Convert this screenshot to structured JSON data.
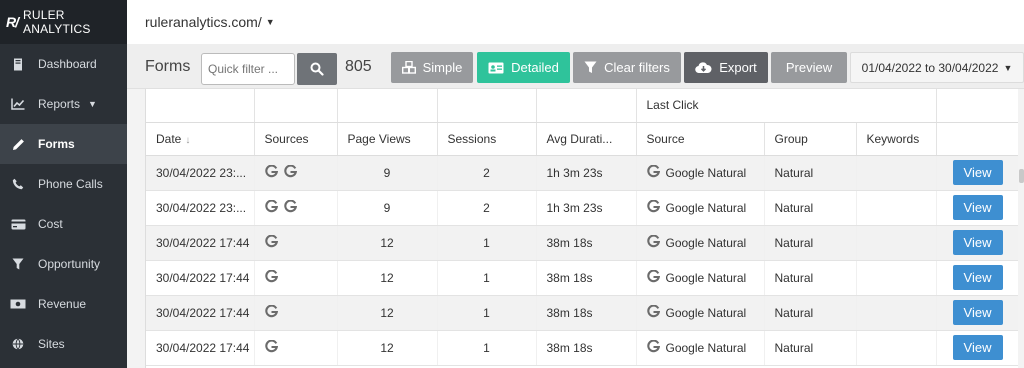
{
  "brand": {
    "mark": "R/",
    "name": "RULER ANALYTICS"
  },
  "sidebar": {
    "items": [
      {
        "label": "Dashboard",
        "icon": "dashboard-icon",
        "active": false
      },
      {
        "label": "Reports",
        "icon": "chart-icon",
        "active": false,
        "has_caret": true
      },
      {
        "label": "Forms",
        "icon": "pencil-icon",
        "active": true
      },
      {
        "label": "Phone Calls",
        "icon": "phone-icon",
        "active": false
      },
      {
        "label": "Cost",
        "icon": "credit-card-icon",
        "active": false
      },
      {
        "label": "Opportunity",
        "icon": "filter-icon",
        "active": false
      },
      {
        "label": "Revenue",
        "icon": "money-icon",
        "active": false
      },
      {
        "label": "Sites",
        "icon": "globe-icon",
        "active": false
      }
    ]
  },
  "topbar": {
    "site": "ruleranalytics.com/"
  },
  "toolbar": {
    "title": "Forms",
    "quick_filter_placeholder": "Quick filter ...",
    "count": "805",
    "simple_label": "Simple",
    "detailed_label": "Detailed",
    "clear_label": "Clear filters",
    "export_label": "Export",
    "preview_label": "Preview",
    "date_range": "01/04/2022 to 30/04/2022"
  },
  "table": {
    "group_header": "Last Click",
    "columns": [
      "Date",
      "Sources",
      "Page Views",
      "Sessions",
      "Avg Durati...",
      "Source",
      "Group",
      "Keywords"
    ],
    "view_label": "View",
    "rows": [
      {
        "date": "30/04/2022 23:...",
        "sources": 2,
        "page_views": "9",
        "sessions": "2",
        "avg_duration": "1h 3m 23s",
        "source": "Google Natural",
        "group": "Natural",
        "keywords": ""
      },
      {
        "date": "30/04/2022 23:...",
        "sources": 2,
        "page_views": "9",
        "sessions": "2",
        "avg_duration": "1h 3m 23s",
        "source": "Google Natural",
        "group": "Natural",
        "keywords": ""
      },
      {
        "date": "30/04/2022 17:44",
        "sources": 1,
        "page_views": "12",
        "sessions": "1",
        "avg_duration": "38m 18s",
        "source": "Google Natural",
        "group": "Natural",
        "keywords": ""
      },
      {
        "date": "30/04/2022 17:44",
        "sources": 1,
        "page_views": "12",
        "sessions": "1",
        "avg_duration": "38m 18s",
        "source": "Google Natural",
        "group": "Natural",
        "keywords": ""
      },
      {
        "date": "30/04/2022 17:44",
        "sources": 1,
        "page_views": "12",
        "sessions": "1",
        "avg_duration": "38m 18s",
        "source": "Google Natural",
        "group": "Natural",
        "keywords": ""
      },
      {
        "date": "30/04/2022 17:44",
        "sources": 1,
        "page_views": "12",
        "sessions": "1",
        "avg_duration": "38m 18s",
        "source": "Google Natural",
        "group": "Natural",
        "keywords": ""
      }
    ]
  },
  "colors": {
    "sidebar": "#2b3036",
    "detailed": "#2fc39b",
    "view_button": "#3e8fd1",
    "export": "#5f6166"
  }
}
